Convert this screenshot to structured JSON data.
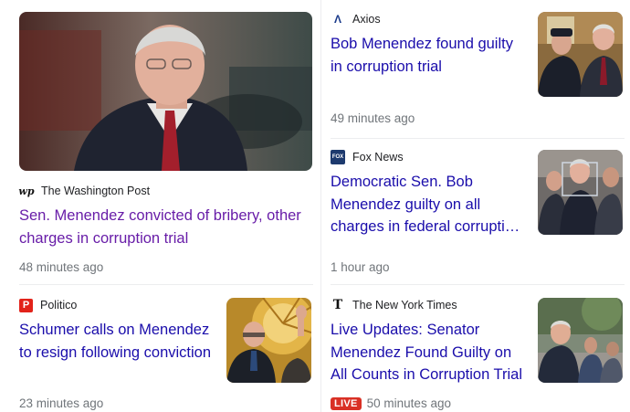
{
  "articles": [
    {
      "source": "The Washington Post",
      "logo": "washington-post-logo",
      "headline": "Sen. Menendez convicted of bribery, other charges in corruption trial",
      "time": "48 minutes ago"
    },
    {
      "source": "Axios",
      "logo": "axios-logo",
      "headline": "Bob Menendez found guilty in corruption trial",
      "time": "49 minutes ago"
    },
    {
      "source": "Fox News",
      "logo": "fox-news-logo",
      "headline": "Democratic Sen. Bob Menendez guilty on all charges in federal corruption trial",
      "time": "1 hour ago"
    },
    {
      "source": "Politico",
      "logo": "politico-logo",
      "headline": "Schumer calls on Menendez to resign following conviction",
      "time": "23 minutes ago"
    },
    {
      "source": "The New York Times",
      "logo": "new-york-times-logo",
      "headline": "Live Updates: Senator Menendez Found Guilty on All Counts in Corruption Trial",
      "time": "50 minutes ago",
      "badge": "LIVE"
    }
  ],
  "logo_marks": {
    "wapo": "wp",
    "axios": "Λ",
    "politico": "P",
    "nyt": "T",
    "fox": "FOX"
  },
  "colors": {
    "headline_link": "#1a0dab",
    "headline_visited": "#681da8",
    "meta_text": "#70757a",
    "live_badge": "#d93025",
    "politico_red": "#e2231a"
  }
}
